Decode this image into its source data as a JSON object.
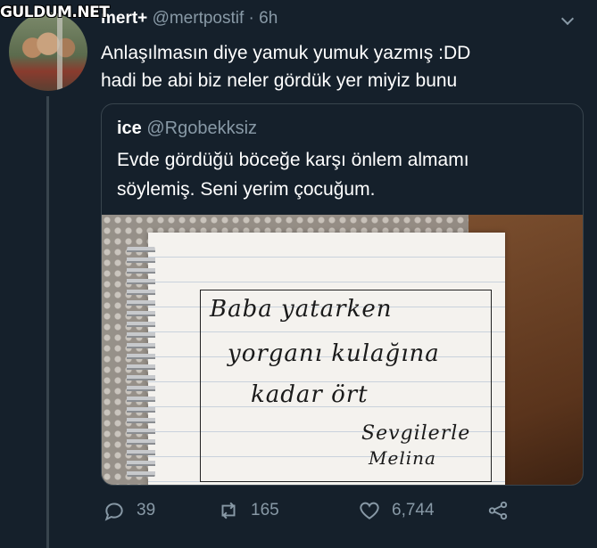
{
  "watermark": "GULDUM.NET",
  "tweet": {
    "name": "mert+",
    "handle": "@mertpostif",
    "separator": "·",
    "time": "6h",
    "text": "Anlaşılmasın diye yamuk yumuk yazmış :DD\nhadi be abi biz neler gördük yer miyiz bunu"
  },
  "quote": {
    "name": "ice",
    "handle": "@Rgobekksiz",
    "text": "Evde gördüğü böceğe karşı önlem almamı\nsöylemiş. Seni yerim çocuğum.",
    "note_lines": [
      "Baba yatarken",
      "yorganı kulağına",
      "kadar ört",
      "Sevgilerle",
      "Melina"
    ]
  },
  "actions": {
    "replies": "39",
    "retweets": "165",
    "likes": "6,744"
  },
  "colors": {
    "background": "#15202b",
    "secondary_text": "#8899a6",
    "border": "#38444d"
  }
}
